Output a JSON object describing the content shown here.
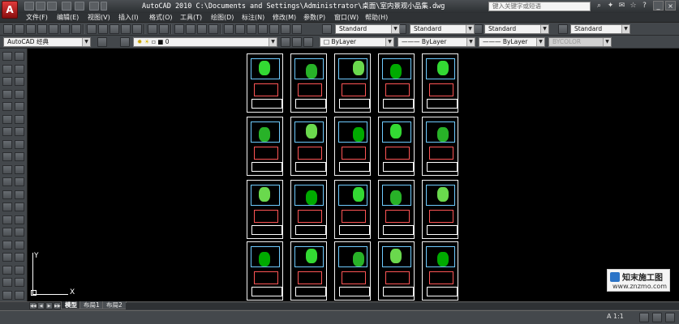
{
  "title_bar": {
    "app_logo": "A",
    "title": "AutoCAD 2010  C:\\Documents and Settings\\Administrator\\桌面\\室内景观小品集.dwg",
    "search_placeholder": "键入关键字或短语"
  },
  "menu": [
    "文件(F)",
    "编辑(E)",
    "视图(V)",
    "插入(I)",
    "格式(O)",
    "工具(T)",
    "绘图(D)",
    "标注(N)",
    "修改(M)",
    "参数(P)",
    "窗口(W)",
    "帮助(H)"
  ],
  "toolbar_row1": {
    "text_style": "Standard",
    "dim_style": "Standard",
    "table_style": "Standard",
    "multileader_style": "Standard"
  },
  "toolbar_row2": {
    "workspace": "AutoCAD 经典",
    "layer": "0",
    "color": "ByLayer",
    "linetype": "ByLayer",
    "lineweight": "ByLayer",
    "plot_style": "BYCOLOR"
  },
  "ucs": {
    "y_label": "Y",
    "x_label": "X"
  },
  "watermark": {
    "name": "知末施工图",
    "url": "www.znzmo.com"
  },
  "tabs": [
    {
      "label": "模型",
      "active": true
    },
    {
      "label": "布局1",
      "active": false
    },
    {
      "label": "布局2",
      "active": false
    }
  ],
  "status": {
    "annotation_scale": "A 1:1"
  },
  "colors": {
    "drawing_background": "#000000",
    "sheet_border": "#f2f2f2",
    "accent_red": "#c0262a"
  }
}
